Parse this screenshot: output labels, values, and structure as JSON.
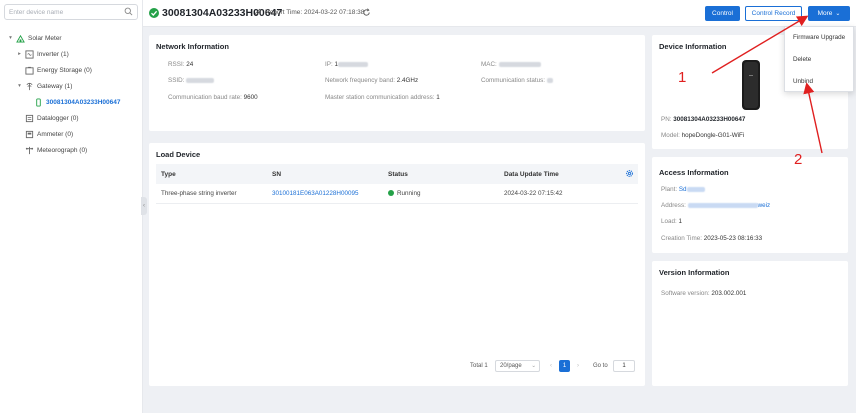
{
  "sidebar": {
    "search_placeholder": "Enter device name",
    "tree": [
      {
        "label": "Solar Meter",
        "arrow": "▾",
        "icon": "plant-icon"
      },
      {
        "label": "Inverter (1)",
        "arrow": "▸",
        "icon": "inverter-icon"
      },
      {
        "label": "Energy Storage (0)",
        "arrow": "",
        "icon": "battery-icon"
      },
      {
        "label": "Gateway (1)",
        "arrow": "▾",
        "icon": "gateway-icon"
      },
      {
        "label": "30081304A03233H00647",
        "arrow": "",
        "icon": "dongle-icon",
        "active": true
      },
      {
        "label": "Datalogger (0)",
        "arrow": "",
        "icon": "datalogger-icon"
      },
      {
        "label": "Ammeter (0)",
        "arrow": "",
        "icon": "ammeter-icon"
      },
      {
        "label": "Meteorograph (0)",
        "arrow": "",
        "icon": "meteorograph-icon"
      }
    ]
  },
  "header": {
    "title": "30081304A03233H00647",
    "report_time": "Report Time: 2024-03-22 07:18:38",
    "control_label": "Control",
    "record_label": "Control Record",
    "more_label": "More"
  },
  "dropdown": {
    "items": [
      "Firmware Upgrade",
      "Delete",
      "Unbind"
    ]
  },
  "network": {
    "title": "Network Information",
    "rssi_label": "RSSI:",
    "rssi_value": "24",
    "ip_label": "IP:",
    "ip_value": "1",
    "mac_label": "MAC:",
    "ssid_label": "SSID:",
    "band_label": "Network frequency band:",
    "band_value": "2.4GHz",
    "comm_status_label": "Communication status:",
    "baud_label": "Communication baud rate:",
    "baud_value": "9600",
    "master_label": "Master station communication address:",
    "master_value": "1"
  },
  "load": {
    "title": "Load Device",
    "columns": [
      "Type",
      "SN",
      "Status",
      "Data Update Time"
    ],
    "rows": [
      {
        "type": "Three-phase string inverter",
        "sn": "30100181E063A01228H00095",
        "status": "Running",
        "time": "2024-03-22 07:15:42"
      }
    ],
    "pager": {
      "total": "Total 1",
      "page_size": "20/page",
      "current": "1",
      "goto_label": "Go to",
      "goto_value": "1"
    }
  },
  "device": {
    "title": "Device Information",
    "pn_label": "PN:",
    "pn_value": "30081304A03233H00647",
    "model_label": "Model:",
    "model_value": "hopeDongle-G01-WiFi"
  },
  "access": {
    "title": "Access Information",
    "plant_label": "Plant:",
    "plant_value": "Sd",
    "address_label": "Address:",
    "address_value": "weiz",
    "load_label": "Load:",
    "load_value": "1",
    "creation_label": "Creation Time:",
    "creation_value": "2023-05-23 08:16:33"
  },
  "version": {
    "title": "Version Information",
    "software_label": "Software version:",
    "software_value": "203.002.001"
  },
  "annotations": {
    "num1": "1",
    "num2": "2",
    "color": "#e02020"
  },
  "colors": {
    "accent": "#1a6fd6",
    "success": "#24a148"
  }
}
